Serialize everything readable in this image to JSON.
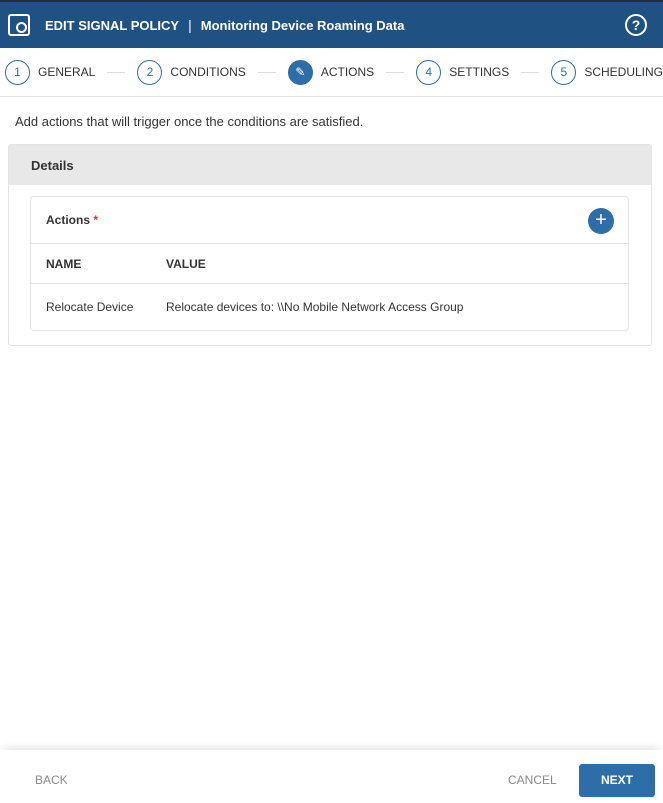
{
  "header": {
    "title": "EDIT SIGNAL POLICY",
    "separator": "|",
    "subtitle": "Monitoring Device Roaming Data",
    "help_label": "?"
  },
  "steps": [
    {
      "number": "1",
      "label": "GENERAL"
    },
    {
      "number": "2",
      "label": "CONDITIONS"
    },
    {
      "number": "",
      "label": "ACTIONS",
      "active": true
    },
    {
      "number": "4",
      "label": "SETTINGS"
    },
    {
      "number": "5",
      "label": "SCHEDULING"
    }
  ],
  "intro": "Add actions that will trigger once the conditions are satisfied.",
  "details": {
    "title": "Details",
    "actions_label": "Actions",
    "required_mark": "*",
    "add_label": "+",
    "columns": [
      "NAME",
      "VALUE"
    ],
    "rows": [
      {
        "name": "Relocate Device",
        "value": "Relocate devices to: \\\\No Mobile Network Access Group"
      }
    ]
  },
  "footer": {
    "back": "BACK",
    "cancel": "CANCEL",
    "next": "NEXT"
  },
  "colors": {
    "header": "#1f5283",
    "accent": "#2d6ea8"
  }
}
